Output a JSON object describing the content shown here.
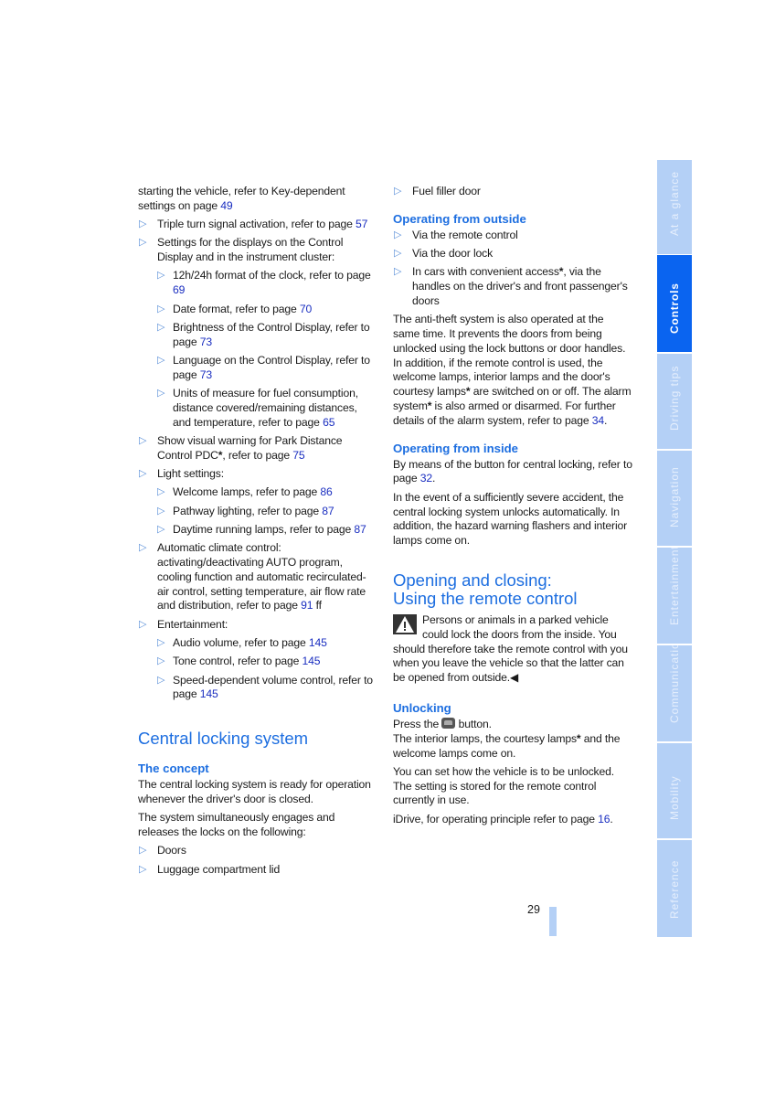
{
  "left_column": {
    "intro": {
      "text": "starting the vehicle, refer to Key-dependent settings on page ",
      "page": "49"
    },
    "items": [
      {
        "text": "Triple turn signal activation, refer to page ",
        "page": "57"
      },
      {
        "text": "Settings for the displays on the Control Display and in the instrument cluster:",
        "sub": [
          {
            "text": "12h/24h format of the clock, refer to page ",
            "page": "69"
          },
          {
            "text": "Date format, refer to page ",
            "page": "70"
          },
          {
            "text": "Brightness of the Control Display, refer to page ",
            "page": "73"
          },
          {
            "text": "Language on the Control Display, refer to page ",
            "page": "73"
          },
          {
            "text": "Units of measure for fuel consumption, distance covered/remaining distances, and temperature, refer to page ",
            "page": "65"
          }
        ]
      },
      {
        "text_before": "Show visual warning for Park Distance Control PDC",
        "star": "*",
        "text_after": ", refer to page ",
        "page": "75"
      },
      {
        "text": "Light settings:",
        "sub": [
          {
            "text": "Welcome lamps, refer to page ",
            "page": "86"
          },
          {
            "text": "Pathway lighting, refer to page ",
            "page": "87"
          },
          {
            "text": "Daytime running lamps, refer to page ",
            "page": "87"
          }
        ]
      },
      {
        "text": "Automatic climate control: activating/deactivating AUTO program, cooling function and automatic recirculated-air control, setting temperature, air flow rate and distribution, refer to page ",
        "page": "91",
        "suffix": " ff"
      },
      {
        "text": "Entertainment:",
        "sub": [
          {
            "text": "Audio volume, refer to page ",
            "page": "145"
          },
          {
            "text": "Tone control, refer to page ",
            "page": "145"
          },
          {
            "text": "Speed-dependent volume control, refer to page ",
            "page": "145"
          }
        ]
      }
    ],
    "section_title": "Central locking system",
    "concept_heading": "The concept",
    "concept_p1": "The central locking system is ready for operation whenever the driver's door is closed.",
    "concept_p2": "The system simultaneously engages and releases the locks on the following:",
    "locks": [
      "Doors",
      "Luggage compartment lid"
    ]
  },
  "right_column": {
    "locks_cont": "Fuel filler door",
    "outside_heading": "Operating from outside",
    "outside_items": [
      "Via the remote control",
      "Via the door lock"
    ],
    "outside_item3": {
      "before": "In cars with convenient access",
      "star": "*",
      "after": ", via the handles on the driver's and front passenger's doors"
    },
    "antitheft": {
      "p1": "The anti-theft system is also operated at the same time. It prevents the doors from being unlocked using the lock buttons or door handles. In addition, if the remote control is used, the welcome lamps, interior lamps and the door's courtesy lamps",
      "p2": " are switched on or off. The alarm system",
      "p3": " is also armed or disarmed. For further details of the alarm system, refer to page ",
      "page": "34",
      "star": "*"
    },
    "inside_heading": "Operating from inside",
    "inside_p1": {
      "text": "By means of the button for central locking, refer to page ",
      "page": "32"
    },
    "inside_p2": "In the event of a sufficiently severe accident, the central locking system unlocks automatically. In addition, the hazard warning flashers and interior lamps come on.",
    "remote_title_1": "Opening and closing:",
    "remote_title_2": "Using the remote control",
    "warning": {
      "text": "Persons or animals in a parked vehicle could lock the doors from the inside. You should therefore take the remote control with you when you leave the vehicle so that the latter can be opened from outside.",
      "end_mark": "◀"
    },
    "unlocking_heading": "Unlocking",
    "unlock_press_before": "Press the ",
    "unlock_press_after": " button.",
    "unlock_lamps_before": "The interior lamps, the courtesy lamps",
    "unlock_lamps_after": " and the welcome lamps come on.",
    "unlock_setting": "You can set how the vehicle is to be unlocked. The setting is stored for the remote control currently in use.",
    "idrive": {
      "text": "iDrive, for operating principle refer to page ",
      "page": "16"
    },
    "star": "*"
  },
  "tabs": [
    {
      "label": "At a glance",
      "active": false
    },
    {
      "label": "Controls",
      "active": true
    },
    {
      "label": "Driving tips",
      "active": false
    },
    {
      "label": "Navigation",
      "active": false
    },
    {
      "label": "Entertainment",
      "active": false
    },
    {
      "label": "Communications",
      "active": false
    },
    {
      "label": "Mobility",
      "active": false
    },
    {
      "label": "Reference",
      "active": false
    }
  ],
  "page_number": "29",
  "bullet_glyph": "▷",
  "colors": {
    "heading": "#1d6ee0",
    "link": "#1a2ec0",
    "tab_active": "#0a64f0",
    "tab_inactive": "#b4d0f6"
  }
}
